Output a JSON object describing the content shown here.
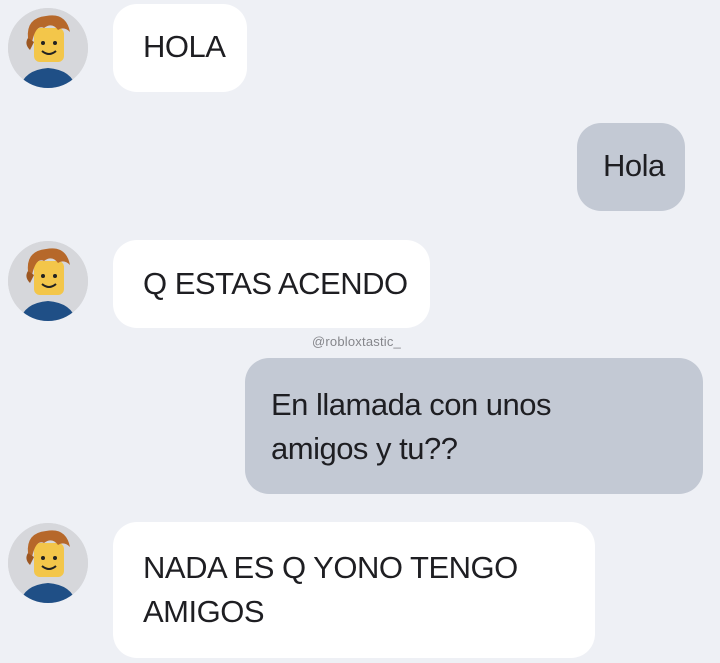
{
  "chat": {
    "watermark": "@robloxtastic_",
    "messages": [
      {
        "sender": "contact",
        "text": "HOLA"
      },
      {
        "sender": "me",
        "text": "Hola"
      },
      {
        "sender": "contact",
        "text": "Q ESTAS ACENDO"
      },
      {
        "sender": "me",
        "lines": [
          "En llamada con unos",
          "amigos y tu??"
        ]
      },
      {
        "sender": "contact",
        "lines": [
          "NADA ES Q YONO TENGO",
          "AMIGOS"
        ]
      }
    ]
  },
  "colors": {
    "background": "#eef0f5",
    "incoming_bubble": "#ffffff",
    "outgoing_bubble": "#c3c9d4",
    "text": "#1e1e22"
  },
  "avatar": {
    "icon": "roblox-bacon-hair-avatar-icon"
  }
}
